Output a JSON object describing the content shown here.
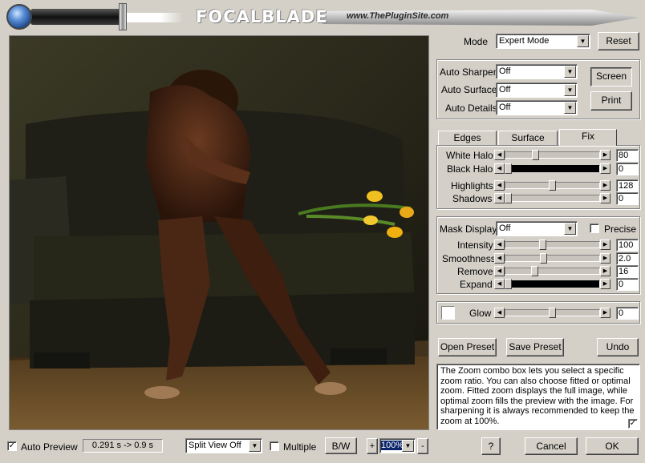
{
  "header": {
    "logo": "FOCALBLADE",
    "site": "www.ThePluginSite.com"
  },
  "mode": {
    "label": "Mode",
    "value": "Expert Mode",
    "reset": "Reset"
  },
  "auto": {
    "sharpen_label": "Auto Sharpen",
    "sharpen": "Off",
    "surface_label": "Auto Surface",
    "surface": "Off",
    "details_label": "Auto Details",
    "details": "Off",
    "screen": "Screen",
    "print": "Print"
  },
  "tabs": [
    "Edges",
    "Surface",
    "Fix"
  ],
  "fix": {
    "white_halo": {
      "label": "White Halo",
      "value": "80",
      "level": 0.31
    },
    "black_halo": {
      "label": "Black Halo",
      "value": "0",
      "level": 0
    },
    "highlights": {
      "label": "Highlights",
      "value": "128",
      "level": 0.5
    },
    "shadows": {
      "label": "Shadows",
      "value": "0",
      "level": 0
    }
  },
  "mask": {
    "display_label": "Mask Display",
    "display": "Off",
    "precise": "Precise",
    "intensity": {
      "label": "Intensity",
      "value": "100",
      "level": 0.39
    },
    "smoothness": {
      "label": "Smoothness",
      "value": "2.0",
      "level": 0.4
    },
    "remove": {
      "label": "Remove",
      "value": "16",
      "level": 0.3
    },
    "expand": {
      "label": "Expand",
      "value": "0",
      "level": 0
    }
  },
  "glow": {
    "label": "Glow",
    "value": "0",
    "level": 0.5
  },
  "presets": {
    "open": "Open Preset",
    "save": "Save Preset",
    "undo": "Undo"
  },
  "help": "The Zoom combo box lets you select a specific zoom ratio. You can also choose fitted or optimal zoom. Fitted zoom displays the full image, while optimal zoom fills the preview with the image. For sharpening it is always recommended to keep the zoom at 100%.",
  "bottom": {
    "auto_preview": "Auto Preview",
    "timing": "0.291 s -> 0.9 s",
    "split": "Split View Off",
    "multiple": "Multiple",
    "bw": "B/W",
    "zoom": "100%",
    "plus": "+",
    "minus": "-",
    "help": "?",
    "cancel": "Cancel",
    "ok": "OK"
  }
}
